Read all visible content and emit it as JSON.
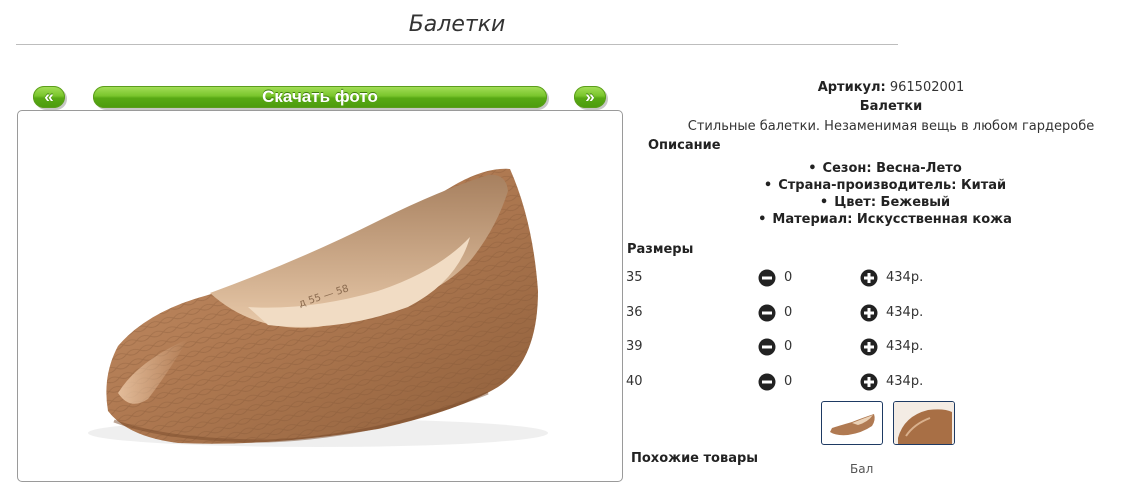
{
  "page": {
    "title": "Балетки"
  },
  "gallery": {
    "prev_label": "«",
    "next_label": "»",
    "download_label": "Скачать фото",
    "photo_imprint": "д 55 — 58",
    "button_color": "#5fb01a"
  },
  "product": {
    "article_label": "Артикул:",
    "article_value": "961502001",
    "name": "Балетки",
    "short_description": "Стильные балетки. Незаменимая вещь в любом гардеробе",
    "description_label": "Описание",
    "properties": [
      "Сезон: Весна-Лето",
      "Страна-производитель: Китай",
      "Цвет: Бежевый",
      "Материал: Искусственная кожа"
    ]
  },
  "sizes": {
    "label": "Размеры",
    "rows": [
      {
        "size": "35",
        "qty": "0",
        "price": "434р."
      },
      {
        "size": "36",
        "qty": "0",
        "price": "434р."
      },
      {
        "size": "39",
        "qty": "0",
        "price": "434р."
      },
      {
        "size": "40",
        "qty": "0",
        "price": "434р."
      }
    ]
  },
  "thumbnails": [
    "shoe-side-thumbnail",
    "shoe-closeup-thumbnail"
  ],
  "similar": {
    "label": "Похожие товары",
    "cut_text": "Бал"
  },
  "icons": {
    "minus": "minus-circle-icon",
    "plus": "plus-circle-icon"
  }
}
